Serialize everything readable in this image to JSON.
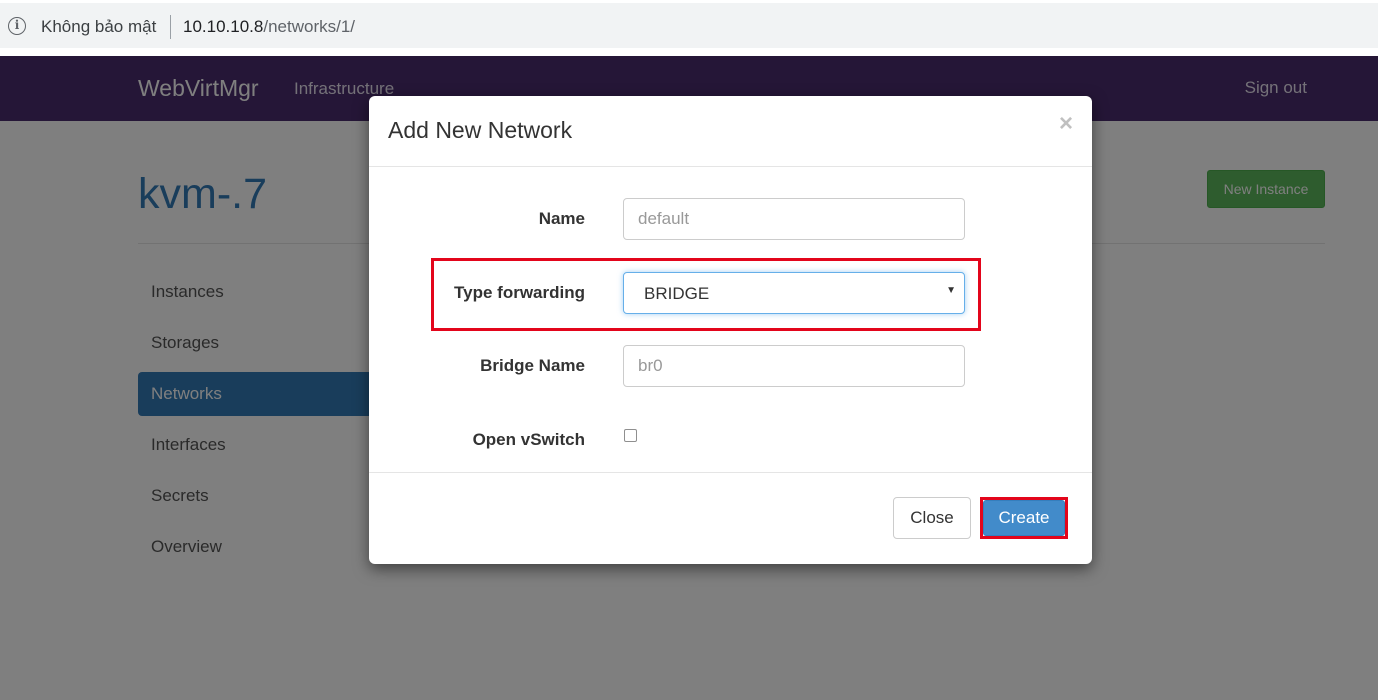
{
  "browser": {
    "security_label": "Không bảo mật",
    "url_host": "10.10.10.8",
    "url_path": "/networks/1/"
  },
  "navbar": {
    "brand": "WebVirtMgr",
    "links": [
      "Infrastructure"
    ],
    "sign_out": "Sign out"
  },
  "page": {
    "title": "kvm-.7",
    "new_instance_label": "New Instance",
    "sidebar": [
      {
        "label": "Instances",
        "active": false
      },
      {
        "label": "Storages",
        "active": false
      },
      {
        "label": "Networks",
        "active": true
      },
      {
        "label": "Interfaces",
        "active": false
      },
      {
        "label": "Secrets",
        "active": false
      },
      {
        "label": "Overview",
        "active": false
      }
    ]
  },
  "modal": {
    "title": "Add New Network",
    "close_icon": "×",
    "fields": {
      "name": {
        "label": "Name",
        "value": "",
        "placeholder": "default"
      },
      "type_forwarding": {
        "label": "Type forwarding",
        "selected": "BRIDGE"
      },
      "bridge_name": {
        "label": "Bridge Name",
        "value": "",
        "placeholder": "br0"
      },
      "open_vswitch": {
        "label": "Open vSwitch",
        "checked": false
      }
    },
    "buttons": {
      "close": "Close",
      "create": "Create"
    }
  },
  "colors": {
    "navbar_bg": "#4a2d6e",
    "primary": "#337ab7",
    "success": "#5cb85c",
    "highlight": "#e3051b",
    "create_button": "#428bca"
  },
  "icons": {
    "security": "info-icon",
    "modal_close": "close-icon",
    "select_caret": "caret-down-icon"
  }
}
